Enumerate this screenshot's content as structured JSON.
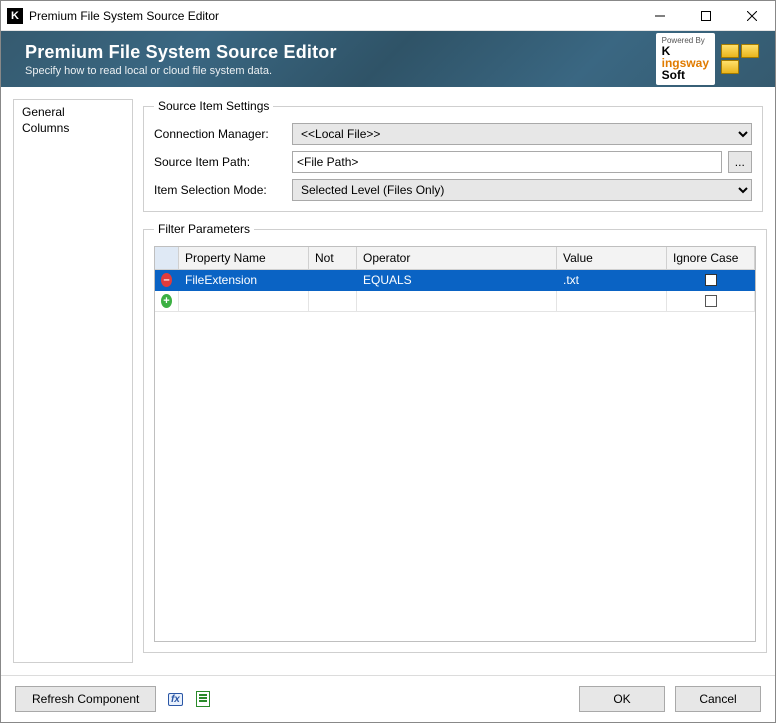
{
  "window": {
    "title": "Premium File System Source Editor",
    "app_icon_letter": "K"
  },
  "banner": {
    "title": "Premium File System Source Editor",
    "subtitle": "Specify how to read local or cloud file system data.",
    "brand_powered": "Powered By",
    "brand_name1": "K",
    "brand_name2": "ingsway",
    "brand_name3": "Soft"
  },
  "sidebar": {
    "items": [
      {
        "label": "General"
      },
      {
        "label": "Columns"
      }
    ]
  },
  "source_settings": {
    "legend": "Source Item Settings",
    "conn_label": "Connection Manager:",
    "conn_value": "<<Local File>>",
    "path_label": "Source Item Path:",
    "path_value": "<File Path>",
    "browse_label": "...",
    "mode_label": "Item Selection Mode:",
    "mode_value": "Selected Level (Files Only)"
  },
  "filter": {
    "legend": "Filter Parameters",
    "headers": {
      "property": "Property Name",
      "not": "Not",
      "operator": "Operator",
      "value": "Value",
      "ignore": "Ignore Case"
    },
    "rows": [
      {
        "property": "FileExtension",
        "not": "",
        "operator": "EQUALS",
        "value": ".txt",
        "ignore": false,
        "selected": true
      },
      {
        "property": "",
        "not": "",
        "operator": "",
        "value": "",
        "ignore": false,
        "selected": false
      }
    ]
  },
  "footer": {
    "refresh": "Refresh Component",
    "ok": "OK",
    "cancel": "Cancel"
  }
}
